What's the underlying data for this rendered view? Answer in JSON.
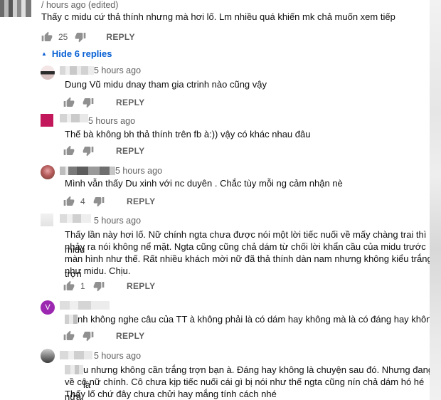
{
  "top_comment": {
    "meta": "/ hours ago (edited)",
    "text": "Thấy c midu cứ thả thính nhưng mà hơi lố. Lm nhiều quá khiến mk chả muốn xem tiếp",
    "likes": "25",
    "reply_label": "REPLY"
  },
  "hide_replies_label": "Hide 6 replies",
  "replies": [
    {
      "time": "5 hours ago",
      "lines": [
        "Dung Vũ midu dnay tham gia ctrinh nào cũng vậy"
      ],
      "likes": "",
      "reply_label": "REPLY"
    },
    {
      "time": "5 hours ago",
      "lines": [
        "Thế bà không bh thả thính trên fb à:)) vậy có khác nhau đâu"
      ],
      "likes": "",
      "reply_label": "REPLY"
    },
    {
      "time": "5 hours ago",
      "lines": [
        "Mình vẫn thấy Du xinh với nc duyên . Chắc tùy mỗi ng cảm nhận nè"
      ],
      "likes": "4",
      "reply_label": "REPLY"
    },
    {
      "time": "5 hours ago",
      "lines": [
        "Thấy lần này hơi lố. Nữ chính ngta chưa được nói một lời tiếc nuối về mấy chàng trai thì midu",
        "nhảy ra nói không nể mặt. Ngta cũng cũng chả dám từ chối lời khẩn cầu của midu trước",
        "màn hình như thế. Rất nhiều khách mời nữ đã thả thính dàn nam nhưng không kiểu trắng trợn",
        "như midu. Chịu."
      ],
      "likes": "1",
      "reply_label": "REPLY"
    },
    {
      "time": "",
      "avatar_letter": "V",
      "lines": [
        "nh không nghe câu của TT à không phải là có dám hay không mà là có đáng hay không"
      ],
      "likes": "",
      "reply_label": "REPLY"
    },
    {
      "time": "5 hours ago",
      "lines": [
        "u nhưng không cần trắng trợn bạn à. Đáng hay không là chuyện sau đó. Nhưng đang là",
        "về cô nữ chính. Cô chưa kịp tiếc nuối cái gì bị nói như thế ngta cũng nín chả dám hó hé nữa.",
        "Thấy lố chứ đây chưa chửi hay mắng tính cách nhé"
      ]
    }
  ]
}
